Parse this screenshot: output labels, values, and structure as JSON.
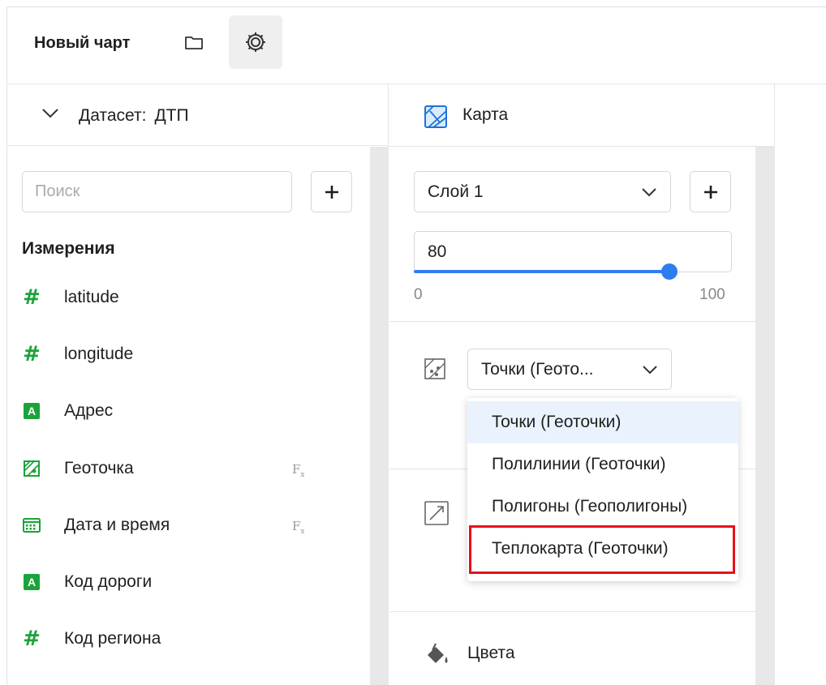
{
  "header": {
    "title": "Новый чарт",
    "icons": {
      "folder": "folder-icon",
      "settings": "gear-icon"
    }
  },
  "dataset": {
    "prefix": "Датасет:",
    "name": "ДТП"
  },
  "search": {
    "placeholder": "Поиск",
    "value": ""
  },
  "dimensions": {
    "title": "Измерения",
    "items": [
      {
        "label": "latitude",
        "icon": "number-type-icon",
        "fx": ""
      },
      {
        "label": "longitude",
        "icon": "number-type-icon",
        "fx": ""
      },
      {
        "label": "Адрес",
        "icon": "string-type-icon",
        "fx": ""
      },
      {
        "label": "Геоточка",
        "icon": "geopoint-type-icon",
        "fx": "F"
      },
      {
        "label": "Дата и время",
        "icon": "datetime-type-icon",
        "fx": "F"
      },
      {
        "label": "Код дороги",
        "icon": "string-type-icon",
        "fx": ""
      },
      {
        "label": "Код региона",
        "icon": "number-type-icon",
        "fx": ""
      }
    ],
    "fx_sub": "x",
    "string_icon_letter": "A"
  },
  "visualization": {
    "type_label": "Карта",
    "layer": "Слой 1",
    "opacity": {
      "value_text": "80",
      "min": "0",
      "max": "100",
      "level": 80
    },
    "geometry_select": "Точки (Геото...",
    "colors_label": "Цвета"
  },
  "dropdown": {
    "options": [
      "Точки (Геоточки)",
      "Полилинии (Геоточки)",
      "Полигоны (Геополигоны)",
      "Теплокарта (Геоточки)"
    ],
    "selected_index": 0,
    "highlighted_index": 3
  },
  "colors": {
    "accent": "#2d7df0",
    "type_green": "#1aa33a",
    "highlight_red": "#e8101a",
    "selected_bg": "#eaf3fd"
  }
}
